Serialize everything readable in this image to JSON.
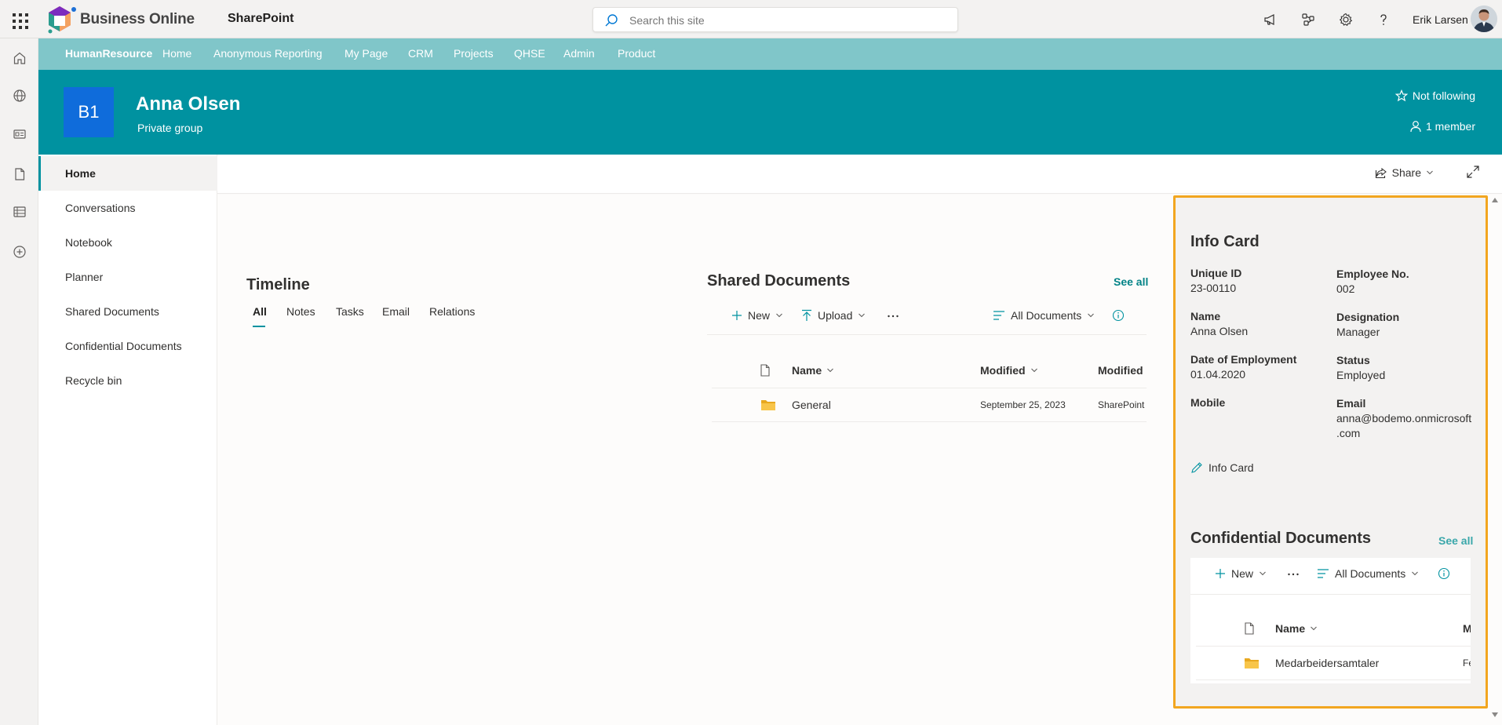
{
  "suite": {
    "brand": "Business Online",
    "app": "SharePoint",
    "search_placeholder": "Search this site",
    "user_name": "Erik Larsen"
  },
  "hub_nav": {
    "items": [
      "HumanResource",
      "Home",
      "Anonymous Reporting",
      "My Page",
      "CRM",
      "Projects",
      "QHSE",
      "Admin",
      "Product"
    ]
  },
  "site": {
    "logo_text": "B1",
    "title": "Anna Olsen",
    "subtitle": "Private group",
    "follow_label": "Not following",
    "members_label": "1 member"
  },
  "quick_launch": {
    "items": [
      "Home",
      "Conversations",
      "Notebook",
      "Planner",
      "Shared Documents",
      "Confidential Documents",
      "Recycle bin"
    ],
    "active": "Home"
  },
  "command_bar": {
    "share_label": "Share"
  },
  "timeline": {
    "title": "Timeline",
    "tabs": [
      "All",
      "Notes",
      "Tasks",
      "Email",
      "Relations"
    ],
    "active_tab": "All"
  },
  "shared_documents": {
    "title": "Shared Documents",
    "see_all": "See all",
    "new_label": "New",
    "upload_label": "Upload",
    "view_label": "All Documents",
    "columns": [
      "Name",
      "Modified",
      "Modified"
    ],
    "rows": [
      {
        "name": "General",
        "modified": "September 25, 2023",
        "modified_by": "SharePoint A"
      }
    ]
  },
  "info_card": {
    "title": "Info Card",
    "fields": {
      "unique_id": {
        "label": "Unique ID",
        "value": "23-00110"
      },
      "employee_no": {
        "label": "Employee No.",
        "value": "002"
      },
      "name": {
        "label": "Name",
        "value": "Anna Olsen"
      },
      "designation": {
        "label": "Designation",
        "value": "Manager"
      },
      "date_of_employment": {
        "label": "Date of Employment",
        "value": "01.04.2020"
      },
      "status": {
        "label": "Status",
        "value": "Employed"
      },
      "mobile": {
        "label": "Mobile",
        "value": ""
      },
      "email": {
        "label": "Email",
        "value_line1": "anna@bodemo.onmicrosoft",
        "value_line2": ".com"
      }
    },
    "edit_label": "Info Card"
  },
  "confidential_documents": {
    "title": "Confidential Documents",
    "see_all": "See all",
    "new_label": "New",
    "view_label": "All Documents",
    "columns": [
      "Name",
      "M"
    ],
    "rows": [
      {
        "name": "Medarbeidersamtaler",
        "modified": "Fe"
      }
    ]
  },
  "colors": {
    "hub": "#80c6c9",
    "header": "#0092a0",
    "accent": "#038387",
    "highlight_border": "#f2a620",
    "folder": "#f8c54a"
  }
}
